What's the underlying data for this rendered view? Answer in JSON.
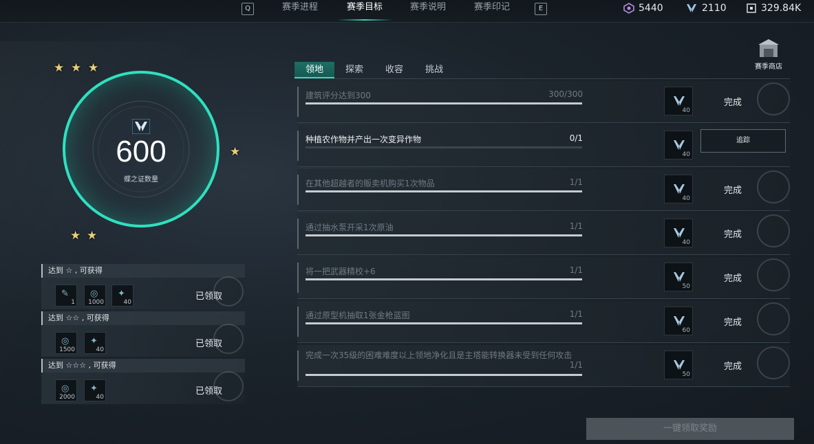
{
  "topbar": {
    "key_left": "Q",
    "key_right": "E",
    "tabs": [
      {
        "label": "赛季进程"
      },
      {
        "label": "赛季目标"
      },
      {
        "label": "赛季说明"
      },
      {
        "label": "赛季印记"
      }
    ],
    "currencies": [
      {
        "icon": "gem-icon",
        "value": "5440"
      },
      {
        "icon": "butterfly-token-icon",
        "value": "2110"
      },
      {
        "icon": "resource-icon",
        "value": "329.84K"
      }
    ]
  },
  "shop": {
    "label": "赛季商店"
  },
  "progress": {
    "value": "600",
    "label": "蝶之证数量"
  },
  "rewards": [
    {
      "head": "达到 ☆ , 可获得",
      "status": "已领取",
      "items": [
        {
          "icon": "gun-icon",
          "count": "1"
        },
        {
          "icon": "coin-icon",
          "count": "1000"
        },
        {
          "icon": "shard-icon",
          "count": "40"
        }
      ]
    },
    {
      "head": "达到 ☆☆ , 可获得",
      "status": "已领取",
      "items": [
        {
          "icon": "coin-icon",
          "count": "1500"
        },
        {
          "icon": "shard-icon",
          "count": "40"
        }
      ]
    },
    {
      "head": "达到 ☆☆☆ , 可获得",
      "status": "已领取",
      "items": [
        {
          "icon": "coin-icon",
          "count": "2000"
        },
        {
          "icon": "shard-icon",
          "count": "40"
        }
      ]
    }
  ],
  "tabs": [
    {
      "label": "领地"
    },
    {
      "label": "探索"
    },
    {
      "label": "收容"
    },
    {
      "label": "挑战"
    }
  ],
  "tasks": [
    {
      "title": "建筑评分达到300",
      "progress": "300/300",
      "fill": 1.0,
      "reward": "40",
      "status": "完成"
    },
    {
      "title": "种植农作物并产出一次变异作物",
      "progress": "0/1",
      "fill": 0.0,
      "reward": "40",
      "status": "追踪"
    },
    {
      "title": "在其他超越者的贩卖机购买1次物品",
      "progress": "1/1",
      "fill": 1.0,
      "reward": "40",
      "status": "完成"
    },
    {
      "title": "通过抽水泵开采1次原油",
      "progress": "1/1",
      "fill": 1.0,
      "reward": "40",
      "status": "完成"
    },
    {
      "title": "将一把武器精校+6",
      "progress": "1/1",
      "fill": 1.0,
      "reward": "50",
      "status": "完成"
    },
    {
      "title": "通过原型机抽取1张金枪蓝图",
      "progress": "1/1",
      "fill": 1.0,
      "reward": "60",
      "status": "完成"
    },
    {
      "title": "完成一次35级的困难难度以上领地净化且是主塔能转换器未受到任何攻击",
      "progress": "1/1",
      "fill": 1.0,
      "reward": "50",
      "status": "完成"
    }
  ],
  "claim_all": {
    "label": "一键领取奖励"
  }
}
